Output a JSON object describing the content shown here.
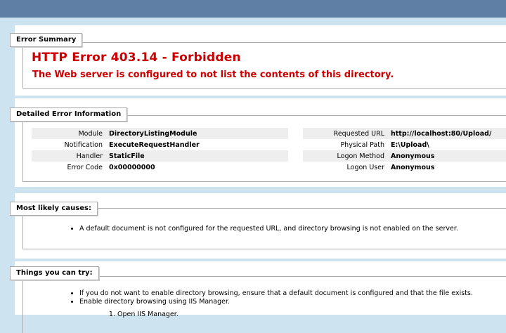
{
  "summary": {
    "legend": "Error Summary",
    "title": "HTTP Error 403.14 - Forbidden",
    "subtitle": "The Web server is configured to not list the contents of this directory."
  },
  "detailed": {
    "legend": "Detailed Error Information",
    "left": [
      {
        "label": "Module",
        "value": "DirectoryListingModule"
      },
      {
        "label": "Notification",
        "value": "ExecuteRequestHandler"
      },
      {
        "label": "Handler",
        "value": "StaticFile"
      },
      {
        "label": "Error Code",
        "value": "0x00000000"
      }
    ],
    "right": [
      {
        "label": "Requested URL",
        "value": "http://localhost:80/Upload/"
      },
      {
        "label": "Physical Path",
        "value": "E:\\Upload\\"
      },
      {
        "label": "Logon Method",
        "value": "Anonymous"
      },
      {
        "label": "Logon User",
        "value": "Anonymous"
      }
    ]
  },
  "causes": {
    "legend": "Most likely causes:",
    "items": [
      "A default document is not configured for the requested URL, and directory browsing is not enabled on the server."
    ]
  },
  "actions": {
    "legend": "Things you can try:",
    "items": [
      "If you do not want to enable directory browsing, ensure that a default document is configured and that the file exists.",
      "Enable directory browsing using IIS Manager."
    ],
    "steps": [
      "Open IIS Manager."
    ]
  }
}
